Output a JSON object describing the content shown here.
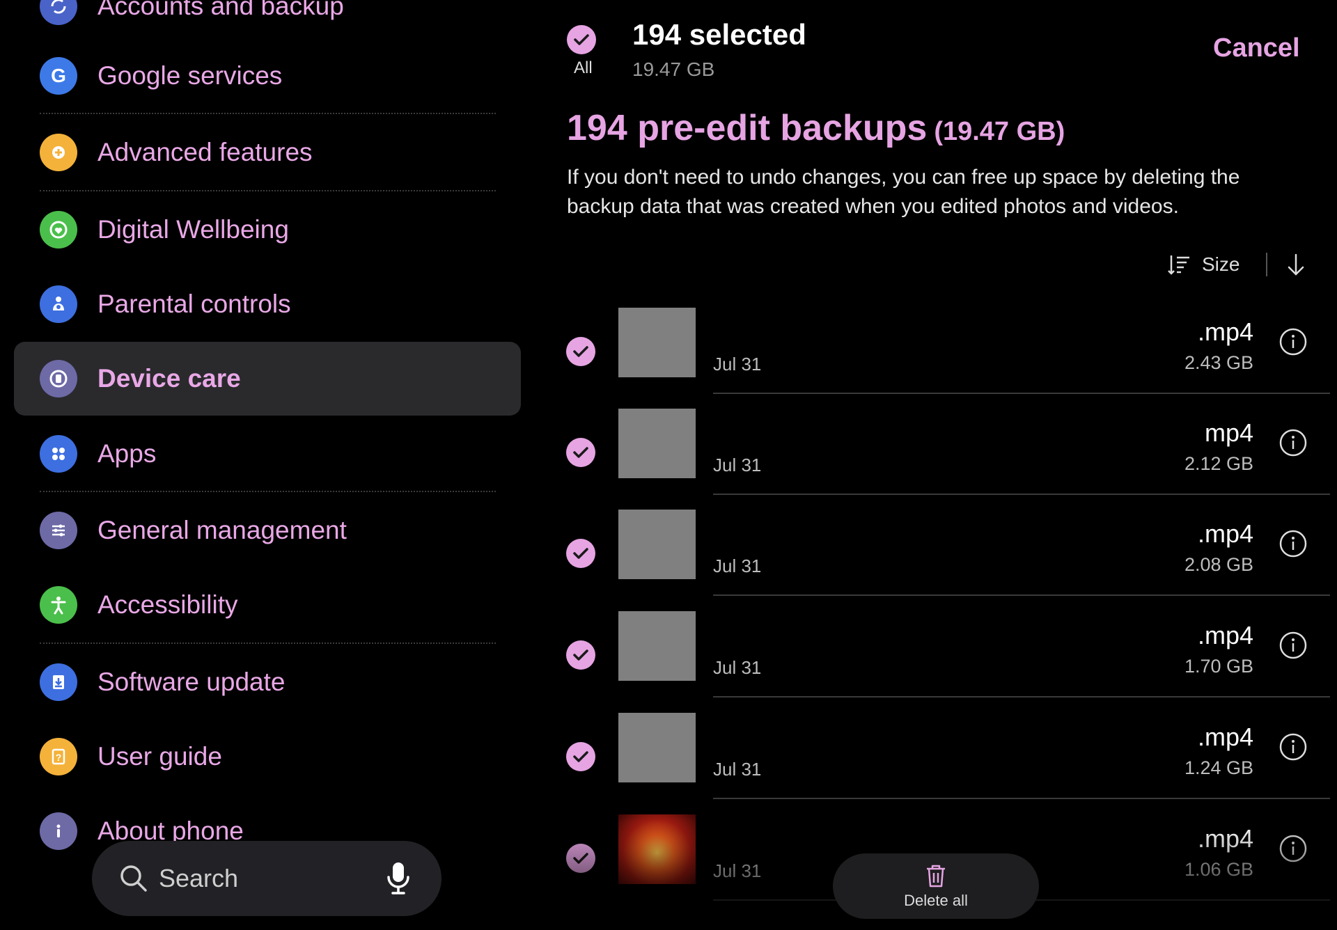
{
  "settings": {
    "items": [
      {
        "label": "Accounts and backup",
        "icon": "sync-icon",
        "color": "#4a63c9"
      },
      {
        "label": "Google services",
        "icon": "google-icon",
        "color": "#3d7ae8"
      },
      {
        "label": "Advanced features",
        "icon": "gear-plus-icon",
        "color": "#f4b23a"
      },
      {
        "label": "Digital Wellbeing",
        "icon": "heart-icon",
        "color": "#4bbf4b"
      },
      {
        "label": "Parental controls",
        "icon": "family-icon",
        "color": "#3d6fe0"
      },
      {
        "label": "Device care",
        "icon": "device-care-icon",
        "color": "#6d6aa6"
      },
      {
        "label": "Apps",
        "icon": "apps-grid-icon",
        "color": "#3d6fe0"
      },
      {
        "label": "General management",
        "icon": "sliders-icon",
        "color": "#6d6aa6"
      },
      {
        "label": "Accessibility",
        "icon": "accessibility-icon",
        "color": "#4bbf4b"
      },
      {
        "label": "Software update",
        "icon": "download-icon",
        "color": "#3d6fe0"
      },
      {
        "label": "User guide",
        "icon": "help-book-icon",
        "color": "#f4b23a"
      },
      {
        "label": "About phone",
        "icon": "info-icon",
        "color": "#6d6aa6"
      }
    ],
    "active": "Device care",
    "search_placeholder": "Search"
  },
  "backups": {
    "all_label": "All",
    "selected_count": "194 selected",
    "selected_size": "19.47 GB",
    "cancel_label": "Cancel",
    "headline": "194 pre-edit backups",
    "headline_size": "(19.47 GB)",
    "description": "If you don't need to undo changes, you can free up space by deleting the backup data that was created when you edited photos and videos.",
    "sort_label": "Size",
    "files": [
      {
        "name": ".mp4",
        "date": "Jul 31",
        "size": "2.43 GB",
        "thumb": "gray"
      },
      {
        "name": "mp4",
        "date": "Jul 31",
        "size": "2.12 GB",
        "thumb": "gray"
      },
      {
        "name": ".mp4",
        "date": "Jul 31",
        "size": "2.08 GB",
        "thumb": "gray"
      },
      {
        "name": ".mp4",
        "date": "Jul 31",
        "size": "1.70 GB",
        "thumb": "gray"
      },
      {
        "name": ".mp4",
        "date": "Jul 31",
        "size": "1.24 GB",
        "thumb": "gray"
      },
      {
        "name": ".mp4",
        "date": "Jul 31",
        "size": "1.06 GB",
        "thumb": "image"
      }
    ],
    "delete_all_label": "Delete all",
    "accent_color": "#e6a4e3"
  }
}
